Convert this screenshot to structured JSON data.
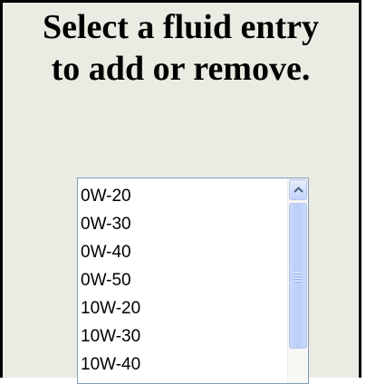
{
  "heading": {
    "line1": "Select a fluid entry",
    "line2": "to add or remove."
  },
  "fluid_list": {
    "items": [
      "0W-20",
      "0W-30",
      "0W-40",
      "0W-50",
      "10W-20",
      "10W-30",
      "10W-40"
    ]
  },
  "icons": {
    "scroll_up": "chevron-up-icon",
    "thumb_grip": "grip-lines-icon"
  },
  "colors": {
    "panel_bg": "#ebebe4",
    "listbox_border": "#7f9db9",
    "scrollbar_accent": "#c3d3fd"
  }
}
